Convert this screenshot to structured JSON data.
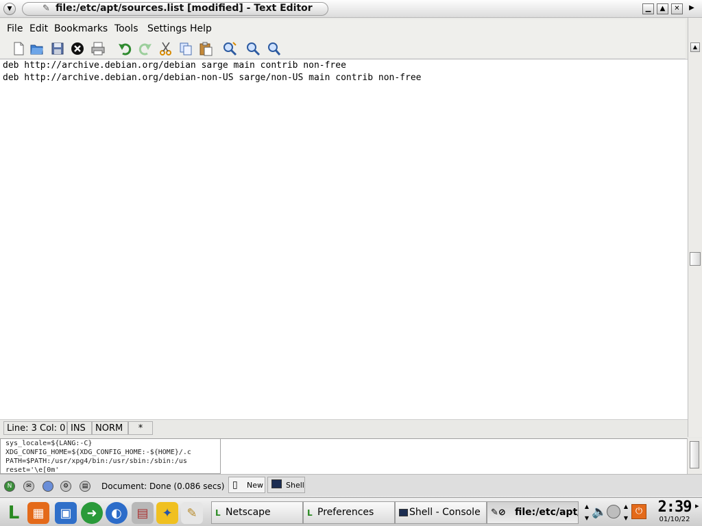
{
  "window": {
    "title": "file:/etc/apt/sources.list [modified] - Text Editor",
    "buttons": {
      "minimize": "▁",
      "maximize": "▲",
      "close": "✕",
      "extra": "▶"
    }
  },
  "menubar": {
    "items": [
      {
        "label": "File",
        "mnemonic": "F"
      },
      {
        "label": "Edit",
        "mnemonic": "E"
      },
      {
        "label": "Bookmarks",
        "mnemonic": "B"
      },
      {
        "label": "Tools",
        "mnemonic": "T"
      },
      {
        "label": "Settings",
        "mnemonic": "S"
      },
      {
        "label": "Help",
        "mnemonic": "H"
      }
    ]
  },
  "toolbar": {
    "icons": [
      "new-document-icon",
      "open-folder-icon",
      "save-icon",
      "close-document-icon",
      "print-icon",
      "undo-icon",
      "redo-icon",
      "cut-icon",
      "copy-icon",
      "paste-icon",
      "find-replace-icon",
      "find-icon",
      "find-next-icon"
    ]
  },
  "editor": {
    "lines": [
      "deb http://archive.debian.org/debian sarge main contrib non-free",
      "deb http://archive.debian.org/debian-non-US sarge/non-US main contrib non-free"
    ]
  },
  "statusbar": {
    "position": "Line: 3 Col: 0",
    "insert_mode": "INS",
    "selection_mode": "NORM",
    "modified": "*"
  },
  "console": {
    "lines": [
      "sys_locale=${LANG:-C}",
      "XDG_CONFIG_HOME=${XDG_CONFIG_HOME:-${HOME}/.c",
      "PATH=$PATH:/usr/xpg4/bin:/usr/sbin:/sbin:/us",
      "reset='\\e[0m'"
    ],
    "new_tab_label": "New",
    "shell_tab_label": "Shell"
  },
  "netscape_status": {
    "document_status": "Document: Done (0.086 secs)"
  },
  "taskbar": {
    "tasks": [
      {
        "label": "Netscape"
      },
      {
        "label": "Preferences"
      },
      {
        "label": "Shell - Console"
      },
      {
        "label": "file:/etc/apt/s"
      }
    ],
    "clock": {
      "time": "2:39",
      "date": "01/10/22"
    }
  },
  "colors": {
    "accent_green": "#2a8a22",
    "selection_blue": "#1f5fbf",
    "power_orange": "#e46a1a"
  }
}
